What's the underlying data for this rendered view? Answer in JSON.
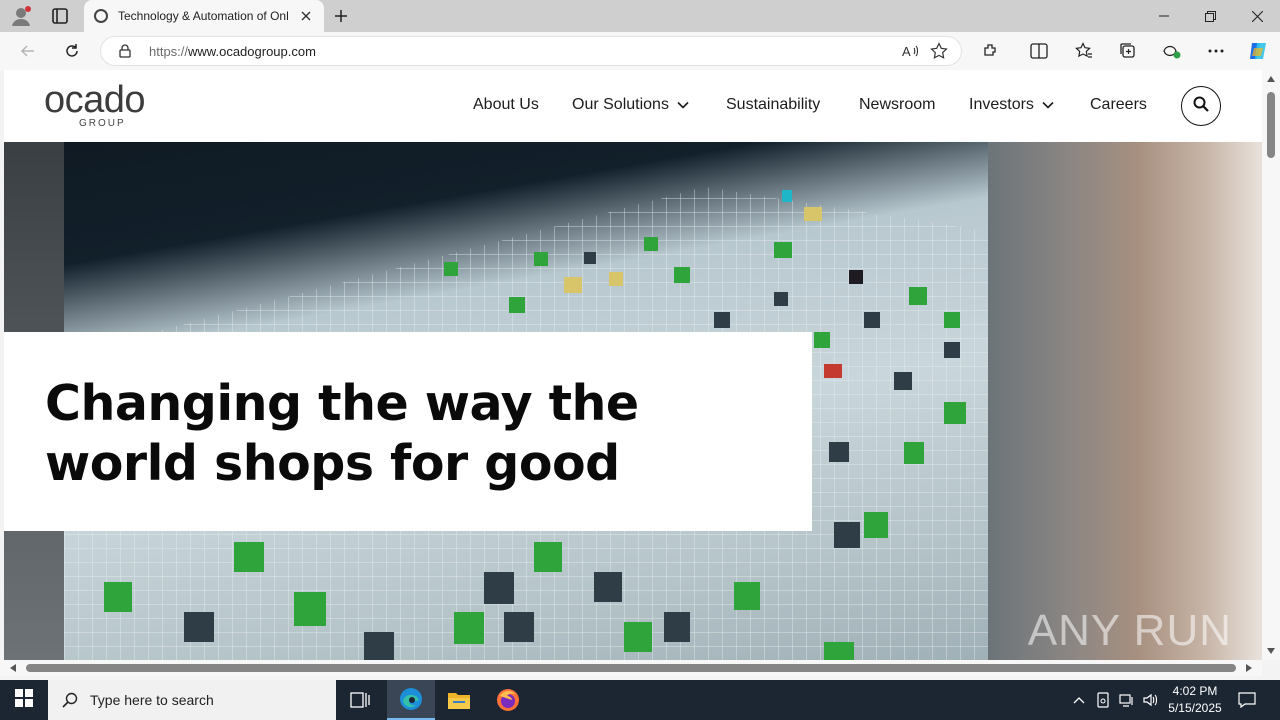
{
  "browser": {
    "tab_title": "Technology & Automation of Onl",
    "url_protocol": "https://",
    "url_host": "www.ocadogroup.com"
  },
  "site": {
    "logo_word": "ocado",
    "logo_sub": "GROUP",
    "nav": [
      {
        "label": "About Us"
      },
      {
        "label": "Our Solutions"
      },
      {
        "label": "Sustainability"
      },
      {
        "label": "Newsroom"
      },
      {
        "label": "Investors"
      },
      {
        "label": "Careers"
      }
    ],
    "hero_heading": "Changing the way the world shops for good"
  },
  "watermark": "ANY RUN",
  "taskbar": {
    "search_placeholder": "Type here to search",
    "time": "4:02 PM",
    "date": "5/15/2025"
  },
  "colors": {
    "taskbar_bg": "#1c2633",
    "titlebar_bg": "#cfcfcf",
    "accent": "#76b9ed"
  }
}
